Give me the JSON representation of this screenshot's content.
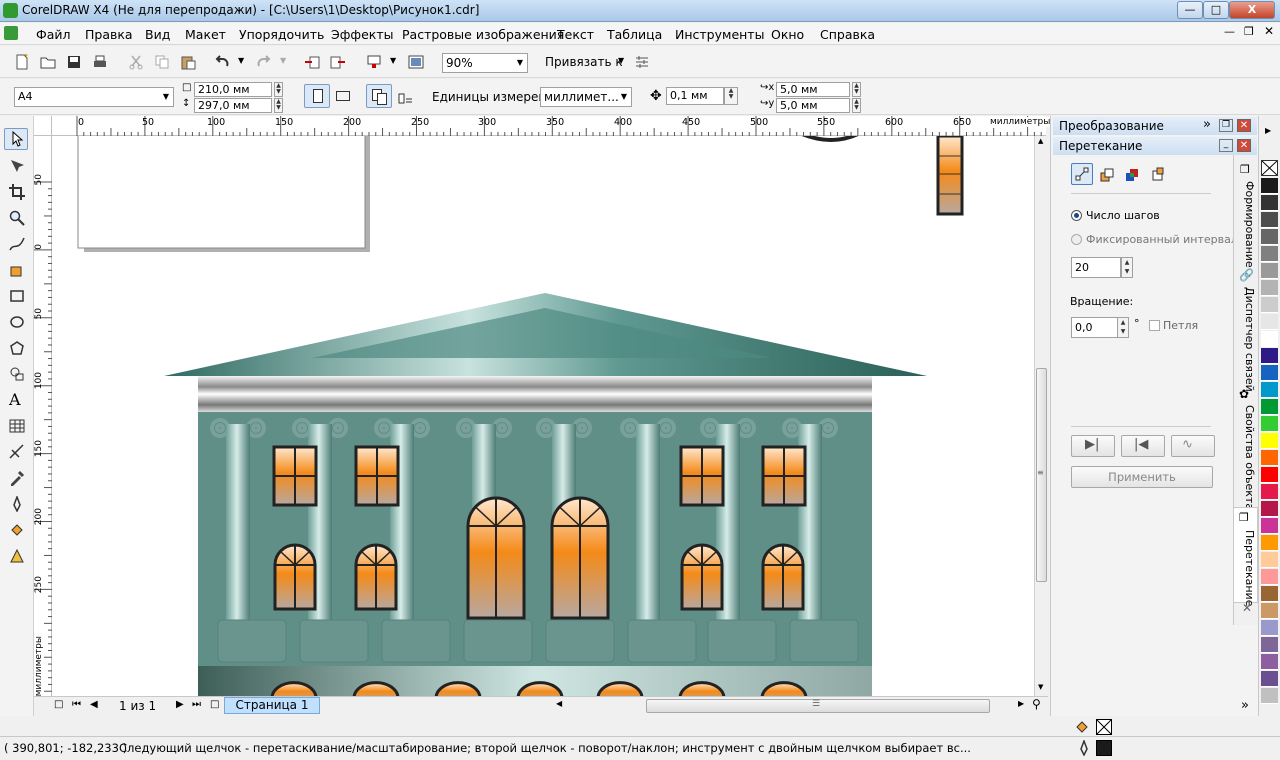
{
  "window": {
    "title": "CorelDRAW X4 (Не для перепродажи) - [C:\\Users\\1\\Desktop\\Рисунок1.cdr]"
  },
  "menu": [
    "Файл",
    "Правка",
    "Вид",
    "Макет",
    "Упорядочить",
    "Эффекты",
    "Растровые изображения",
    "Текст",
    "Таблица",
    "Инструменты",
    "Окно",
    "Справка"
  ],
  "toolbar": {
    "zoom": "90%",
    "snap_label": "Привязать к"
  },
  "propbar": {
    "page_size": "A4",
    "width": "210,0 мм",
    "height": "297,0 мм",
    "units_label": "Единицы измерения:",
    "units_value": "миллимет...",
    "nudge": "0,1 мм",
    "dup_x": "5,0 мм",
    "dup_y": "5,0 мм"
  },
  "ruler": {
    "top_ticks": [
      "0",
      "50",
      "100",
      "150",
      "200",
      "250",
      "300",
      "350",
      "400",
      "450",
      "500",
      "550",
      "600",
      "650"
    ],
    "unit": "миллиметры",
    "left_ticks": [
      "50",
      "0",
      "50",
      "100",
      "150",
      "200",
      "250"
    ]
  },
  "docker": {
    "panel1_title": "Преобразование",
    "panel2_title": "Перетекание",
    "radio_steps": "Число шагов",
    "radio_fixed": "Фиксированный интервал",
    "steps_value": "20",
    "rotation_label": "Вращение:",
    "rotation_value": "0,0",
    "degree": "°",
    "loop_label": "Петля",
    "apply": "Применить",
    "tabs": [
      "Формирование",
      "Диспетчер связей",
      "Свойства объекта",
      "Перетекание"
    ]
  },
  "pagenav": {
    "counter": "1 из 1",
    "page_tab": "Страница 1"
  },
  "status": {
    "coords": "( 390,801; -182,233 )",
    "message": "Следующий щелчок - перетаскивание/масштабирование; второй щелчок - поворот/наклон; инструмент с двойным щелчком выбирает вс..."
  },
  "palette_colors": [
    "#1a1a1a",
    "#333333",
    "#4d4d4d",
    "#666666",
    "#808080",
    "#999999",
    "#b3b3b3",
    "#cccccc",
    "#e6e6e6",
    "#ffffff",
    "#2e1a87",
    "#1565c0",
    "#0099cc",
    "#009933",
    "#33cc33",
    "#ffff00",
    "#ff6600",
    "#ff0000",
    "#e6194b",
    "#b5174a",
    "#cc3399",
    "#ff9900",
    "#ffcc99",
    "#ff9999",
    "#996633",
    "#cc9966",
    "#9999cc",
    "#7f6699",
    "#8e5fa0",
    "#6b4f91",
    "#c0c0c0"
  ],
  "colors": {
    "building": "#5f8f87",
    "roof": "#4e8880",
    "window_glow": "#f08a1a"
  }
}
